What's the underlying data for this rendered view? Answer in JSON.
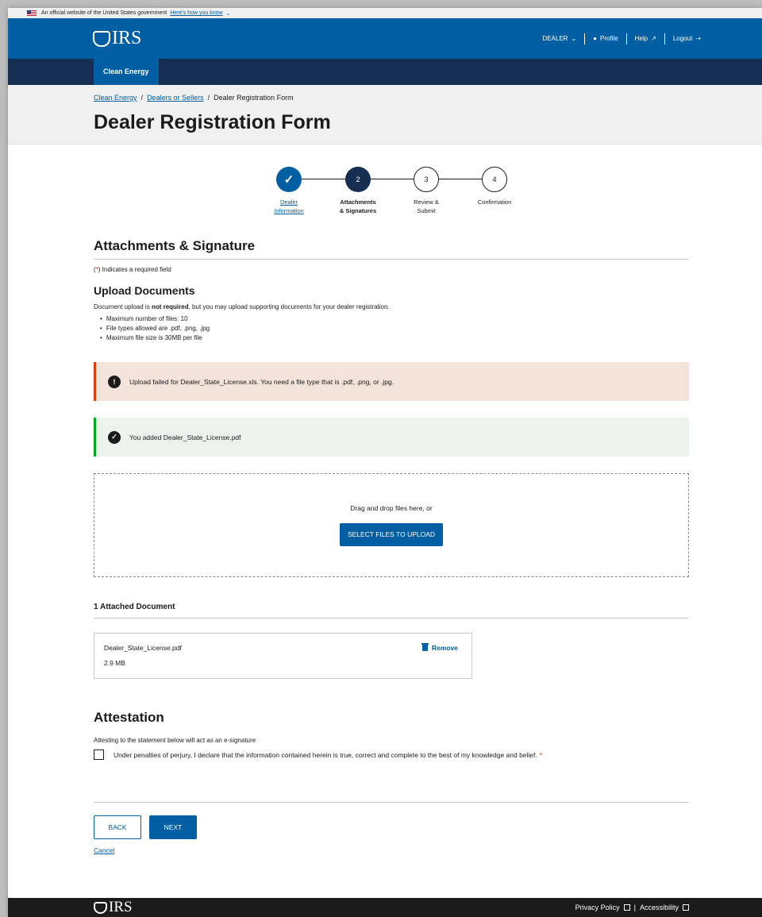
{
  "gov_banner": {
    "text": "An official website of the United States government",
    "link": "Here's how you know"
  },
  "header": {
    "logo": "IRS",
    "dealer": "DEALER",
    "profile": "Profile",
    "help": "Help",
    "logout": "Logout"
  },
  "subnav": {
    "tab": "Clean Energy"
  },
  "breadcrumb": {
    "item1": "Clean Energy",
    "item2": "Dealers or Sellers",
    "current": "Dealer Registration Form"
  },
  "page_title": "Dealer Registration Form",
  "stepper": {
    "step1": {
      "line1": "Dealer",
      "line2": "Information",
      "state": "complete"
    },
    "step2": {
      "num": "2",
      "line1": "Attachments",
      "line2": "& Signatures",
      "state": "current"
    },
    "step3": {
      "num": "3",
      "line1": "Review &",
      "line2": "Submit",
      "state": "upcoming"
    },
    "step4": {
      "num": "4",
      "line1": "Confirmation",
      "state": "upcoming"
    }
  },
  "section": {
    "title": "Attachments & Signature",
    "required_open": "(",
    "required_ast": "*",
    "required_rest": ") Indicates a required field"
  },
  "upload": {
    "title": "Upload Documents",
    "intro_before": "Document upload is ",
    "intro_bold": "not required",
    "intro_after": ", but you may upload supporting documents for your dealer registration.",
    "rules": [
      "Maximum number of files: 10",
      "File types allowed are .pdf, .png, .jpg",
      "Maximum file size is 30MB per file"
    ],
    "error_msg": "Upload failed for Dealer_State_License.xls. You need a file type that is .pdf, .png, or .jpg.",
    "success_msg": "You added Dealer_State_License.pdf",
    "drop_text": "Drag and drop files here, or",
    "select_button": "SELECT FILES TO UPLOAD"
  },
  "attached": {
    "title": "1 Attached Document",
    "file_name": "Dealer_State_License.pdf",
    "file_size": "2.9 MB",
    "remove": "Remove"
  },
  "attestation": {
    "title": "Attestation",
    "desc": "Attesting to the statement below will act as an e-signature",
    "statement": "Under penalties of perjury, I declare that the information contained herein is true, correct and complete to the best of my knowledge and belief.",
    "ast": "*"
  },
  "actions": {
    "back": "BACK",
    "next": "NEXT",
    "cancel": "Cancel"
  },
  "footer": {
    "logo": "IRS",
    "privacy": "Privacy Policy",
    "accessibility": "Accessibility",
    "sep": "|"
  },
  "colors": {
    "primary": "#005ea2",
    "navy": "#162e51",
    "error": "#d54309",
    "success": "#00a91c"
  }
}
